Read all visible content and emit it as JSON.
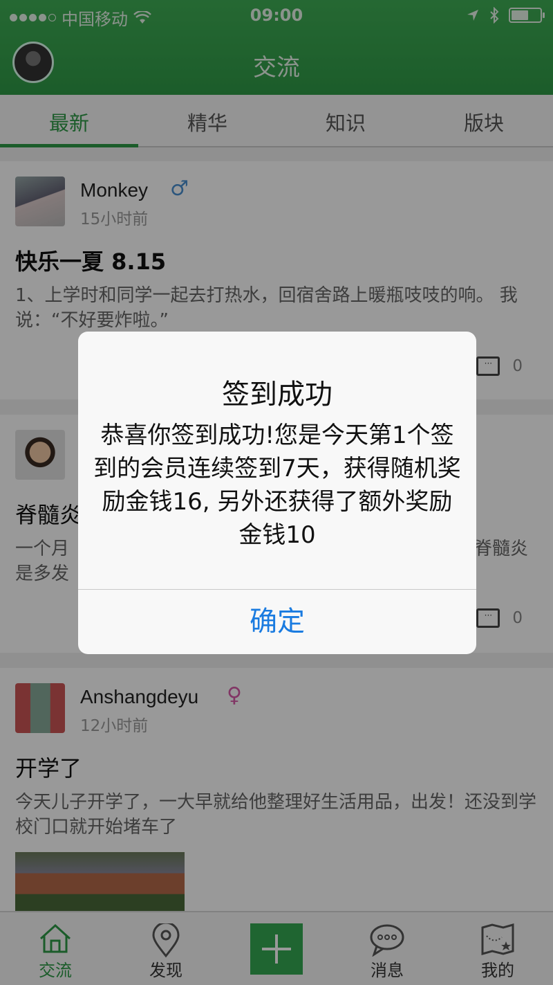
{
  "status_bar": {
    "carrier": "中国移动",
    "time": "09:00"
  },
  "header": {
    "title": "交流"
  },
  "tabs": [
    {
      "label": "最新",
      "active": true
    },
    {
      "label": "精华"
    },
    {
      "label": "知识"
    },
    {
      "label": "版块"
    }
  ],
  "posts": [
    {
      "name": "Monkey",
      "gender": "♂",
      "time": "15小时前",
      "title": "快乐一夏 8.15",
      "body": "1、上学时和同学一起去打热水，回宿舍路上暖瓶吱吱的响。 我说：“不好要炸啦。”",
      "comments": "0"
    },
    {
      "name": "",
      "gender": "",
      "time": "",
      "title": "脊髓炎",
      "body_left": "一个月",
      "body_left2": "是多发",
      "body_right": "脊髓炎",
      "comments": "0"
    },
    {
      "name": "Anshangdeyu",
      "gender": "♀",
      "time": "12小时前",
      "title": "开学了",
      "body": "今天儿子开学了，一大早就给他整理好生活用品，出发！还没到学校门口就开始堵车了"
    }
  ],
  "dialog": {
    "title": "签到成功",
    "message": "恭喜你签到成功!您是今天第1个签到的会员连续签到7天，获得随机奖励金钱16, 另外还获得了额外奖励金钱10",
    "confirm_label": "确定"
  },
  "bottom_nav": [
    {
      "label": "交流",
      "icon": "home-icon",
      "active": true
    },
    {
      "label": "发现",
      "icon": "location-pin-icon"
    },
    {
      "label": "",
      "icon": "plus-icon"
    },
    {
      "label": "消息",
      "icon": "chat-bubble-icon"
    },
    {
      "label": "我的",
      "icon": "map-icon"
    }
  ],
  "colors": {
    "accent": "#2d9a47",
    "dialog_button": "#1a7be0",
    "male": "#4a8fd0",
    "female": "#d75aa8"
  }
}
